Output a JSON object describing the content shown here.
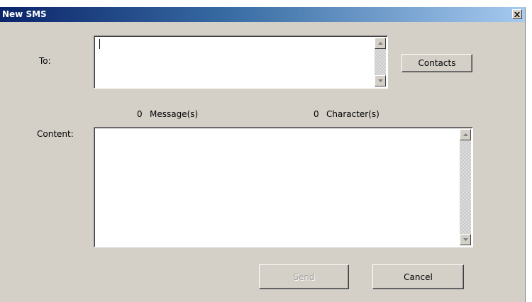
{
  "window": {
    "title": "New SMS",
    "close_glyph": "×"
  },
  "to": {
    "label": "To:",
    "value": ""
  },
  "contacts_button": {
    "label": "Contacts"
  },
  "counters": {
    "message_count": "0",
    "message_label": "Message(s)",
    "character_count": "0",
    "character_label": "Character(s)"
  },
  "content": {
    "label": "Content:",
    "value": ""
  },
  "send_button": {
    "label": "Send",
    "enabled": false
  },
  "cancel_button": {
    "label": "Cancel"
  },
  "colors": {
    "title_gradient_start": "#0a246a",
    "title_gradient_end": "#a6caf0",
    "dialog_face": "#d4d0c8",
    "disabled_text": "#a0a0a0"
  },
  "icons": {
    "close": "close-icon",
    "scroll_up": "arrow-up-icon",
    "scroll_down": "arrow-down-icon"
  }
}
